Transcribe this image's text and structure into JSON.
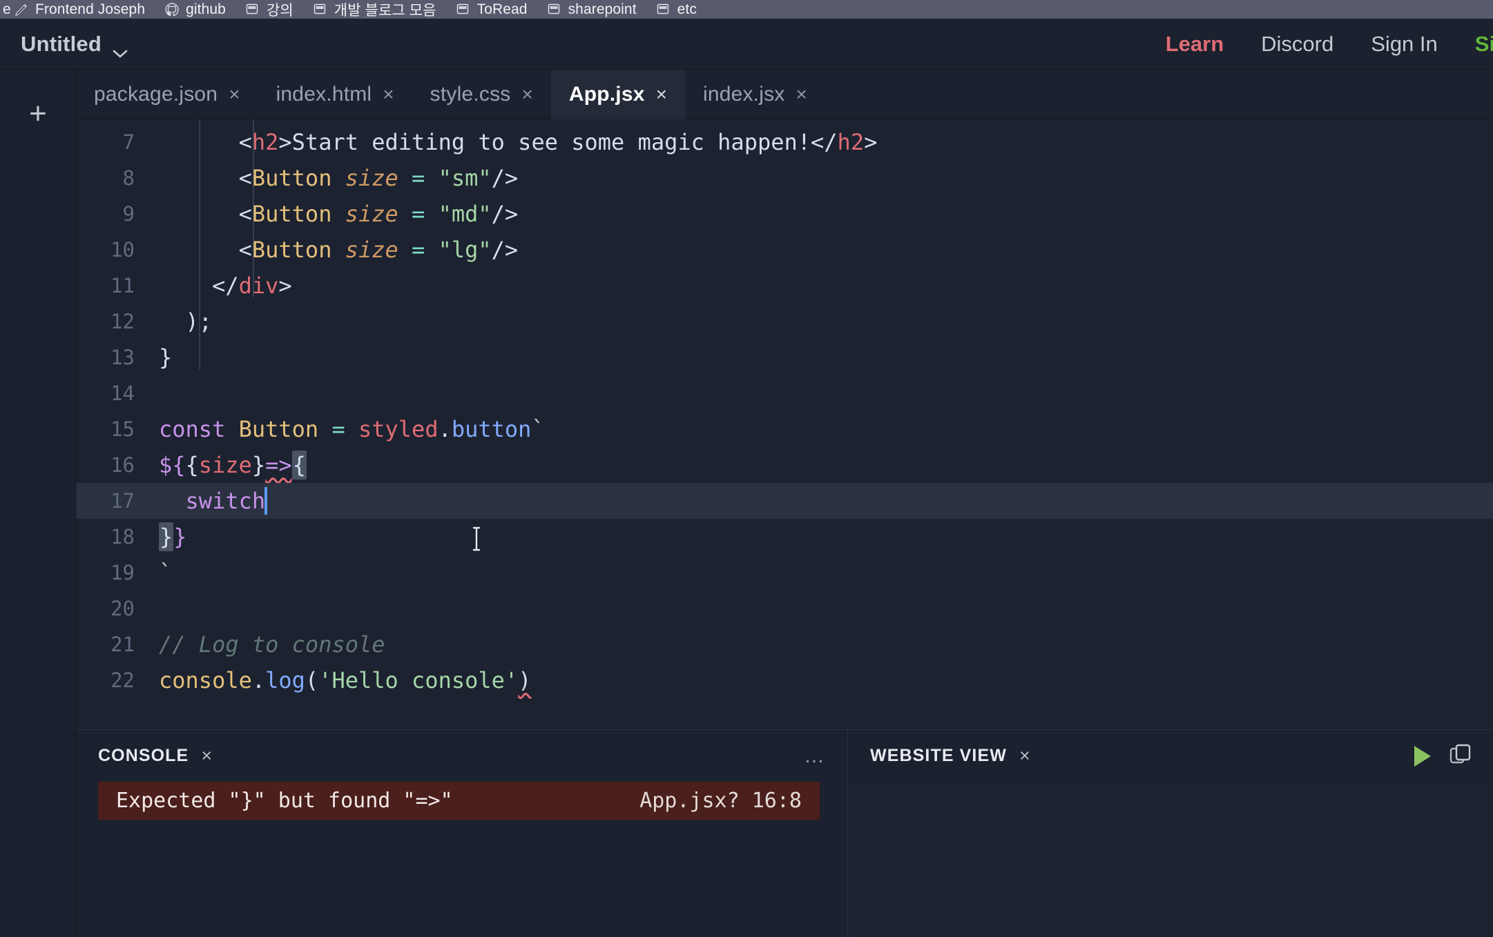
{
  "browser": {
    "bookmarks": [
      {
        "label": "Frontend Joseph",
        "icon": "pencil-icon"
      },
      {
        "label": "github",
        "icon": "github-icon"
      },
      {
        "label": "강의",
        "icon": "folder-icon"
      },
      {
        "label": "개발 블로그 모음",
        "icon": "folder-icon"
      },
      {
        "label": "ToRead",
        "icon": "folder-icon"
      },
      {
        "label": "sharepoint",
        "icon": "folder-icon"
      },
      {
        "label": "etc",
        "icon": "folder-icon"
      }
    ]
  },
  "topbar": {
    "sandbox_name": "Untitled",
    "nav": [
      {
        "label": "Learn",
        "color": "#e06c75"
      },
      {
        "label": "Discord",
        "color": "#c5cad4"
      },
      {
        "label": "Sign In",
        "color": "#c5cad4"
      },
      {
        "label": "Sig",
        "color": "#63b53a"
      }
    ]
  },
  "rail": {
    "add_file_label": "+",
    "add_panel_label": "+"
  },
  "tabs": [
    {
      "name": "package.json",
      "close": "×",
      "active": false
    },
    {
      "name": "index.html",
      "close": "×",
      "active": false
    },
    {
      "name": "style.css",
      "close": "×",
      "active": false
    },
    {
      "name": "App.jsx",
      "close": "×",
      "active": true
    },
    {
      "name": "index.jsx",
      "close": "×",
      "active": false
    }
  ],
  "editor": {
    "active_file": "App.jsx",
    "first_line_number": 7,
    "lines": [
      {
        "n": "7",
        "text": "      <h2>Start editing to see some magic happen!</h2>"
      },
      {
        "n": "8",
        "text": "      <Button size = \"sm\"/>"
      },
      {
        "n": "9",
        "text": "      <Button size = \"md\"/>"
      },
      {
        "n": "10",
        "text": "      <Button size = \"lg\"/>"
      },
      {
        "n": "11",
        "text": "    </div>"
      },
      {
        "n": "12",
        "text": "  );"
      },
      {
        "n": "13",
        "text": "}"
      },
      {
        "n": "14",
        "text": ""
      },
      {
        "n": "15",
        "text": "const Button = styled.button`"
      },
      {
        "n": "16",
        "text": "${{size}=>{"
      },
      {
        "n": "17",
        "text": "  switch"
      },
      {
        "n": "18",
        "text": "}}"
      },
      {
        "n": "19",
        "text": "`"
      },
      {
        "n": "20",
        "text": ""
      },
      {
        "n": "21",
        "text": "// Log to console"
      },
      {
        "n": "22",
        "text": "console.log('Hello console')"
      }
    ],
    "cursor_line": 17,
    "cursor_column": 9
  },
  "console_panel": {
    "title": "CONSOLE",
    "close": "×",
    "menu": "…",
    "messages": [
      {
        "text": "Expected \"}\" but found \"=>\"",
        "location": "App.jsx? 16:8",
        "severity": "error"
      }
    ]
  },
  "website_panel": {
    "title": "WEBSITE VIEW",
    "close": "×",
    "run_icon": "play-icon",
    "external_icon": "copy-icon"
  },
  "colors": {
    "editor_bg": "#1c2230",
    "chrome_bg": "#1b212e",
    "bookmark_bg": "#585b6e",
    "accent_green": "#63b53a",
    "accent_red": "#e06c75",
    "error_bg": "#4a1f1c"
  }
}
